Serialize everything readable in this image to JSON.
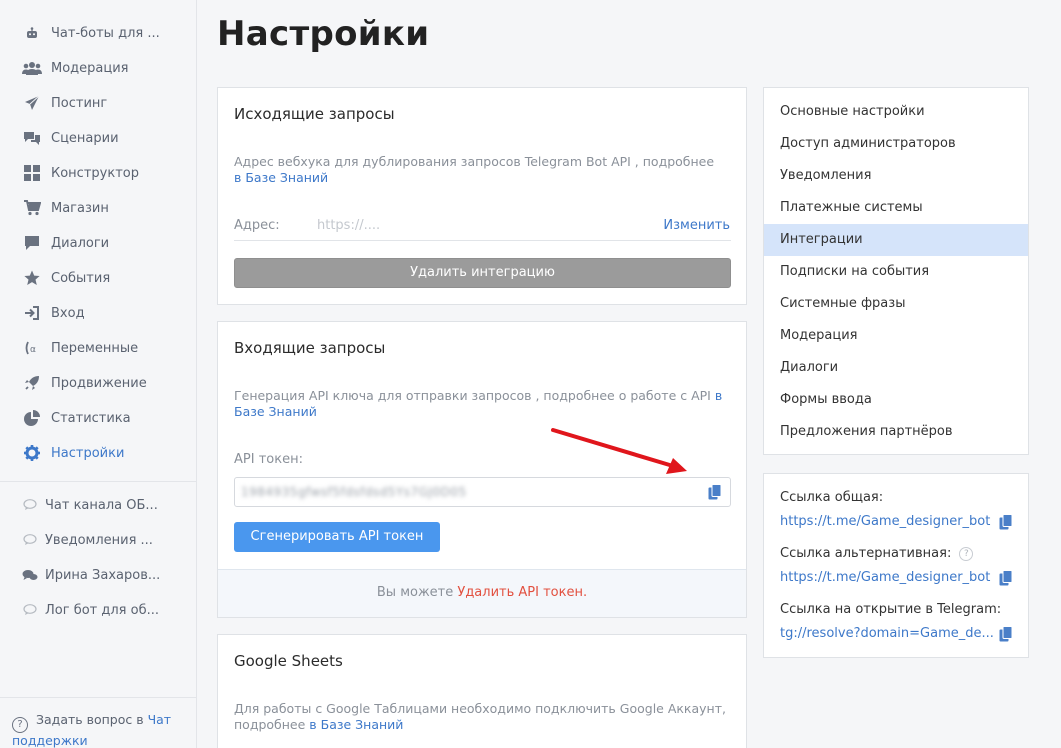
{
  "sidebar": {
    "nav": [
      {
        "label": "Чат-боты для ...",
        "icon": "robot-icon"
      },
      {
        "label": "Модерация",
        "icon": "users-icon"
      },
      {
        "label": "Постинг",
        "icon": "send-icon"
      },
      {
        "label": "Сценарии",
        "icon": "chat-bubbles-icon"
      },
      {
        "label": "Конструктор",
        "icon": "grid-icon"
      },
      {
        "label": "Магазин",
        "icon": "cart-icon"
      },
      {
        "label": "Диалоги",
        "icon": "chat-icon"
      },
      {
        "label": "События",
        "icon": "star-icon"
      },
      {
        "label": "Вход",
        "icon": "sign-in-icon"
      },
      {
        "label": "Переменные",
        "icon": "variable-icon"
      },
      {
        "label": "Продвижение",
        "icon": "rocket-icon"
      },
      {
        "label": "Статистика",
        "icon": "pie-chart-icon"
      },
      {
        "label": "Настройки",
        "icon": "gear-icon"
      }
    ],
    "chats": [
      {
        "label": "Чат канала ОБ..."
      },
      {
        "label": "Уведомления ..."
      },
      {
        "label": "Ирина Захаров..."
      },
      {
        "label": "Лог бот для об..."
      }
    ],
    "help_text": "Задать вопрос в ",
    "help_link": "Чат поддержки"
  },
  "page_title": "Настройки",
  "outgoing": {
    "title": "Исходящие запросы",
    "desc": "Адрес вебхука для дублирования запросов Telegram Bot API , подробнее",
    "desc_link": "в Базе Знаний",
    "address_label": "Адрес:",
    "address_placeholder": "https://....",
    "change_link": "Изменить",
    "delete_button": "Удалить интеграцию"
  },
  "incoming": {
    "title": "Входящие запросы",
    "desc": "Генерация API ключа для отправки запросов , подробнее о работе с API",
    "desc_link_1": "в",
    "desc_link_2": "Базе Знаний",
    "token_label": "API токен:",
    "token_value": "1984935gfwsf5fdsfdsd5Ys7GJ0D05",
    "generate_button": "Сгенерировать API токен",
    "footer_text": "Вы можете ",
    "footer_link": "Удалить API токен."
  },
  "google": {
    "title": "Google Sheets",
    "desc": "Для работы с Google Таблицами необходимо подключить Google Аккаунт,",
    "desc_2": "подробнее ",
    "desc_link": "в Базе Знаний"
  },
  "settings_menu": [
    {
      "label": "Основные настройки",
      "active": false
    },
    {
      "label": "Доступ администраторов",
      "active": false
    },
    {
      "label": "Уведомления",
      "active": false
    },
    {
      "label": "Платежные системы",
      "active": false
    },
    {
      "label": "Интеграции",
      "active": true
    },
    {
      "label": "Подписки на события",
      "active": false
    },
    {
      "label": "Системные фразы",
      "active": false
    },
    {
      "label": "Модерация",
      "active": false
    },
    {
      "label": "Диалоги",
      "active": false
    },
    {
      "label": "Формы ввода",
      "active": false
    },
    {
      "label": "Предложения партнёров",
      "active": false
    }
  ],
  "links": {
    "general_label": "Ссылка общая:",
    "general_value": "https://t.me/Game_designer_bot",
    "alt_label": "Ссылка альтернативная:",
    "alt_value": "https://t.me/Game_designer_bot",
    "telegram_label": "Ссылка на открытие в Telegram:",
    "telegram_value": "tg://resolve?domain=Game_de..."
  },
  "colors": {
    "accent": "#4a97ee",
    "link": "#3d78c9",
    "danger": "#e2503f",
    "active_menu_bg": "#d5e4fa",
    "arrow": "#e0161c"
  }
}
